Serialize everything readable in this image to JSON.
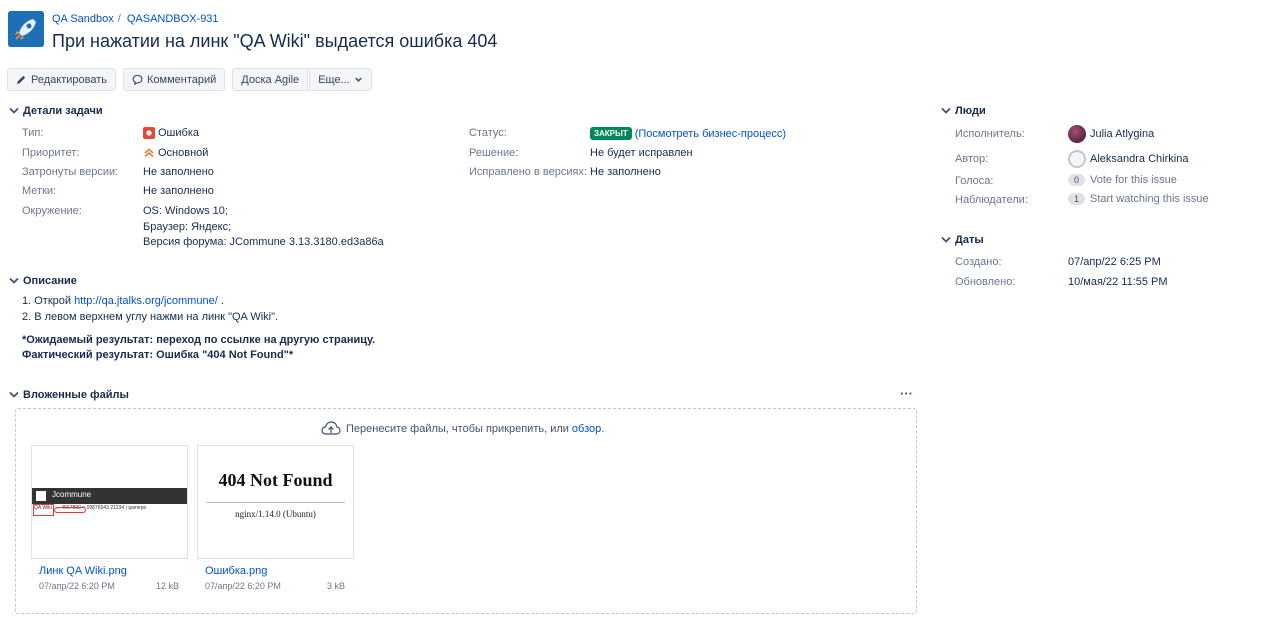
{
  "header": {
    "project_name": "QA Sandbox",
    "issue_key": "QASANDBOX-931",
    "title": "При нажатии на линк \"QA Wiki\" выдается ошибка 404"
  },
  "toolbar": {
    "edit": "Редактировать",
    "comment": "Комментарий",
    "agile": "Доска Agile",
    "more": "Еще..."
  },
  "details": {
    "heading": "Детали задачи",
    "type_label": "Тип:",
    "type_value": "Ошибка",
    "priority_label": "Приоритет:",
    "priority_value": "Основной",
    "affects_label": "Затронуты версии:",
    "affects_value": "Не заполнено",
    "labels_label": "Метки:",
    "labels_value": "Не заполнено",
    "env_label": "Окружение:",
    "env_lines": [
      "OS: Windows 10;",
      "Браузер: Яндекс;",
      "Версия форума: JCommune 3.13.3180.ed3a86a"
    ],
    "status_label": "Статус:",
    "status_value": "ЗАКРЫТ",
    "status_link": "(Посмотреть бизнес-процесс)",
    "resolution_label": "Решение:",
    "resolution_value": "Не будет исправлен",
    "fixed_label": "Исправлено в версиях:",
    "fixed_value": "Не заполнено"
  },
  "description": {
    "heading": "Описание",
    "step1_prefix": "1. Открой ",
    "step1_link": "http://qa.jtalks.org/jcommune/",
    "step1_suffix": " .",
    "step2": "2. В левом верхнем углу нажми на линк \"QA Wiki\".",
    "expected": "*Ожидаемый результат: переход по ссылке на другую страницу.",
    "actual": "Фактический результат: Ошибка \"404 Not Found\"*"
  },
  "attachments": {
    "heading": "Вложенные файлы",
    "more": "···",
    "drop_text": "Перенесите файлы, чтобы прикрепить, или ",
    "drop_link": "обзор.",
    "files": [
      {
        "name": "Линк QA Wiki.png",
        "date": "07/апр/22 6:20 PM",
        "size": "12 kB",
        "thumb_title": "Jcommune",
        "thumb_bar": "QA Wiki | ... 4567890 = 09876543 21234 | qamirpo"
      },
      {
        "name": "Ошибка.png",
        "date": "07/апр/22 6:20 PM",
        "size": "3 kB",
        "thumb_title": "404 Not Found",
        "thumb_sub": "nginx/1.14.0 (Ubuntu)"
      }
    ]
  },
  "people": {
    "heading": "Люди",
    "assignee_label": "Исполнитель:",
    "assignee": "Julia Atlygina",
    "reporter_label": "Автор:",
    "reporter": "Aleksandra Chirkina",
    "votes_label": "Голоса:",
    "votes_count": "0",
    "votes_text": "Vote for this issue",
    "watchers_label": "Наблюдатели:",
    "watchers_count": "1",
    "watchers_text": "Start watching this issue"
  },
  "dates": {
    "heading": "Даты",
    "created_label": "Создано:",
    "created": "07/апр/22 6:25 PM",
    "updated_label": "Обновлено:",
    "updated": "10/мая/22 11:55 PM"
  }
}
